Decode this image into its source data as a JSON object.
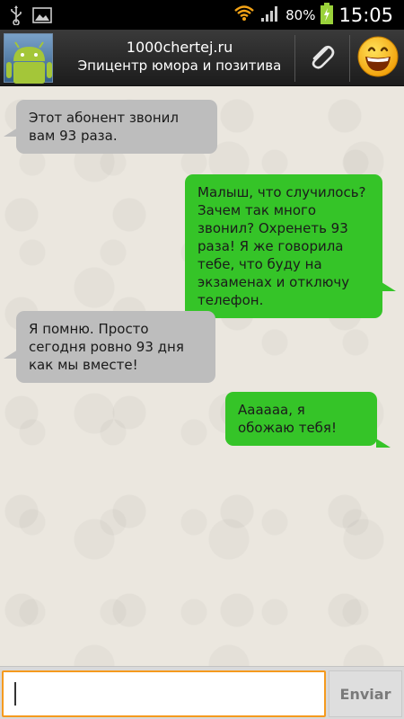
{
  "status_bar": {
    "battery_percent": "80%",
    "time": "15:05",
    "icons": [
      "usb-icon",
      "image-icon",
      "wifi-icon",
      "signal-icon",
      "battery-charging-icon"
    ]
  },
  "header": {
    "title": "1000chertej.ru",
    "subtitle": "Эпицентр юмора и позитива",
    "avatar_icon": "android-icon",
    "attach_icon": "paperclip-icon",
    "emoji_icon": "smiley-icon"
  },
  "messages": [
    {
      "direction": "incoming",
      "text": "Этот абонент звонил вам 93 раза."
    },
    {
      "direction": "outgoing",
      "text": "Малыш, что случилось? Зачем так много звонил? Охренеть 93 раза! Я же говорила тебе, что буду на экзаменах и отключу телефон."
    },
    {
      "direction": "incoming",
      "text": "Я помню. Просто сегодня ровно 93 дня как мы вместе!"
    },
    {
      "direction": "outgoing",
      "text": "Аааааа, я обожаю тебя!"
    }
  ],
  "composer": {
    "value": "",
    "send_label": "Enviar"
  },
  "colors": {
    "incoming_bubble": "#bdbdbd",
    "outgoing_bubble": "#35c428",
    "input_focus_border": "#f59a1e"
  }
}
